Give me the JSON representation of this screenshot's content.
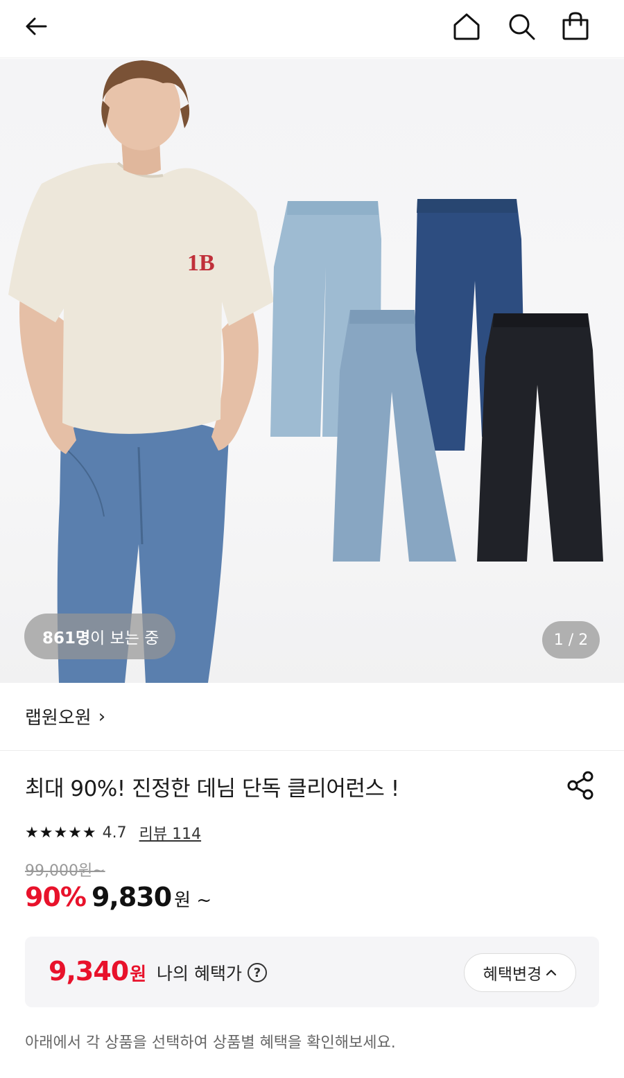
{
  "header": {
    "back_icon": "arrow-left-icon",
    "home_icon": "home-icon",
    "search_icon": "search-icon",
    "cart_icon": "shopping-bag-icon"
  },
  "hero": {
    "viewers_count": "861명",
    "viewers_suffix": "이 보는 중",
    "pager": "1 / 2",
    "logo_text": "LB"
  },
  "brand": {
    "name": "랩원오원",
    "chevron": "›"
  },
  "product": {
    "title": "최대 90%! 진정한 데님 단독 클리어런스 !",
    "stars": "★★★★★",
    "rating": "4.7",
    "review_label": "리뷰 114",
    "original_price": "99,000원~",
    "discount": "90%",
    "sale_price": "9,830",
    "sale_suffix": "원 ~"
  },
  "benefit": {
    "price": "9,340",
    "won": "원",
    "label": "나의 혜택가",
    "help": "?",
    "change_label": "혜택변경",
    "change_chevron": "^"
  },
  "notice": "아래에서 각 상품을 선택하여 상품별 혜택을 확인해보세요.",
  "colors": {
    "accent_red": "#e8122b",
    "benefit_bg": "#f5f5f7",
    "jeans_light": "#9ebbd2",
    "jeans_stone": "#88a6c2",
    "jeans_dark": "#2d4d80",
    "jeans_black": "#202228"
  }
}
